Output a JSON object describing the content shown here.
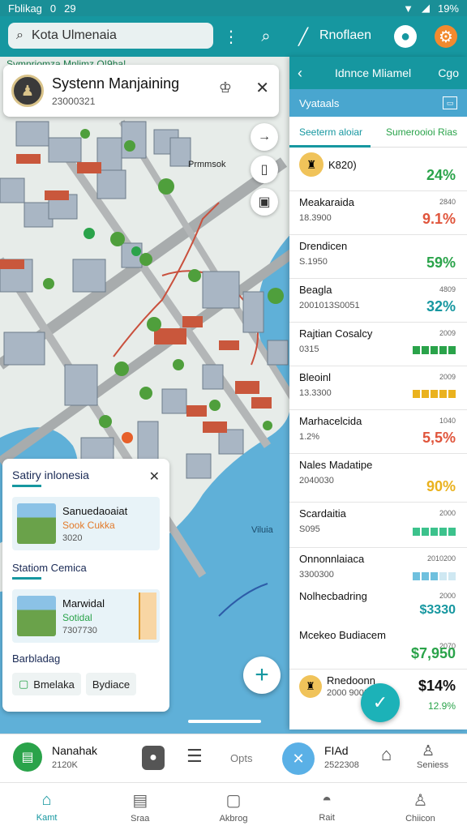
{
  "status_bar": {
    "left": "Fblikag",
    "icons": [
      "0",
      "29"
    ],
    "battery": "19%"
  },
  "app_bar": {
    "search_value": "Kota Ulmenaia",
    "title": "Rnoflaen"
  },
  "info_card": {
    "title": "Systenn Manjaining",
    "subtitle": "23000321"
  },
  "map_labels": {
    "top": "Svmnriomza Mnlimz Q!9ha!",
    "building": "Prmmsok",
    "district": "Viluia"
  },
  "pois": {
    "header": "Satiry inlonesia",
    "items": [
      {
        "title": "Sanuedaoaiat",
        "tag": "Sook Cukka",
        "code": "3020"
      },
      {
        "title": "Marwidal",
        "tag": "Sotidal",
        "code": "7307730"
      }
    ],
    "section2": "Statiom Cemica",
    "section3": "Barbladag",
    "chips": [
      "Bmelaka",
      "Bydiace"
    ]
  },
  "panel": {
    "header": "Idnnce Mliamel",
    "header_right": "Cgo",
    "sub_title": "Vyataals",
    "tabs": [
      "Seeterm aloiar",
      "Sumerooioi Rias"
    ],
    "rows": [
      {
        "name": "K820)",
        "meta": "",
        "small": "",
        "value": "24%",
        "color": "#2aa34a"
      },
      {
        "name": "Meakaraida",
        "meta": "18.3900",
        "small": "2840",
        "value": "9.1%",
        "color": "#e0553c"
      },
      {
        "name": "Drendicen",
        "meta": "S.1950",
        "small": "",
        "value": "59%",
        "color": "#2aa34a"
      },
      {
        "name": "Beagla",
        "meta": "2001013S0051",
        "small": "4809",
        "value": "32%",
        "color": "#1697a0"
      },
      {
        "name": "Rajtian Cosalcy",
        "meta": "0315",
        "small": "2009",
        "value": "",
        "color": "#2aa34a"
      },
      {
        "name": "Bleoinl",
        "meta": "13.3300",
        "small": "2009",
        "value": "",
        "color": "#eab21e"
      },
      {
        "name": "Marhacelcida",
        "meta": "1.2%",
        "small": "1040",
        "value": "5,5%",
        "color": "#e0553c"
      },
      {
        "name": "Nales Madatipe",
        "meta": "2040030",
        "small": "",
        "value": "90%",
        "color": "#eab21e"
      },
      {
        "name": "Scardaitia",
        "meta": "S095",
        "small": "2000",
        "value": "",
        "color": "#3cc28c"
      },
      {
        "name": "Onnonnlaiaca",
        "meta": "3300300",
        "small": "2010200",
        "value": "",
        "color": "#6fc0de"
      },
      {
        "name": "Nolhecbadring",
        "meta": "",
        "small": "2000",
        "value": "$3330",
        "color": "#1697a0"
      },
      {
        "name": "Mcekeo Budiacem",
        "meta": "",
        "small": "2070",
        "value": "$7,950",
        "color": "#2aa34a"
      },
      {
        "name": "Rnedoonn",
        "meta": "2000 9000",
        "small": "",
        "value": "$14%",
        "color": "#111111"
      }
    ],
    "last_sub": "12.9%"
  },
  "action_bar": {
    "left_title": "Nanahak",
    "left_sub": "2120K",
    "opts": "Opts",
    "right_title": "FIAd",
    "right_sub": "2522308",
    "far_right": "Seniess"
  },
  "bottom_nav": [
    "Kamt",
    "Sraa",
    "Akbrog",
    "Rait",
    "Chiicon"
  ]
}
